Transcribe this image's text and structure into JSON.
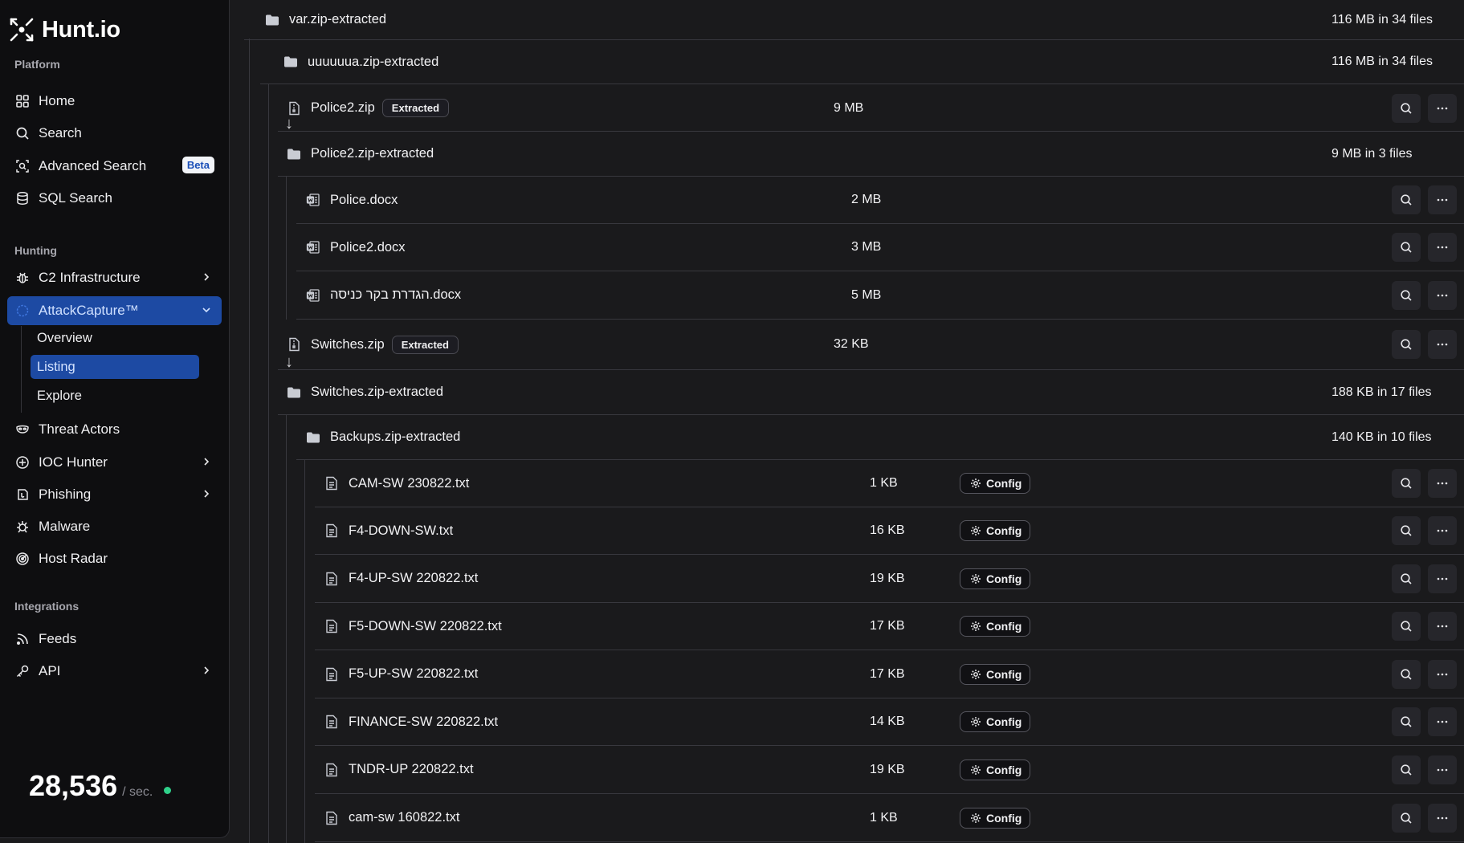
{
  "brand": {
    "name": "Hunt.io"
  },
  "sidebar": {
    "sections": {
      "platform": "Platform",
      "hunting": "Hunting",
      "integrations": "Integrations"
    },
    "items": {
      "home": "Home",
      "search": "Search",
      "advanced_search": "Advanced Search",
      "advanced_search_badge": "Beta",
      "sql_search": "SQL Search",
      "c2_infrastructure": "C2 Infrastructure",
      "attackcapture": "AttackCapture™",
      "threat_actors": "Threat Actors",
      "ioc_hunter": "IOC Hunter",
      "phishing": "Phishing",
      "malware": "Malware",
      "host_radar": "Host Radar",
      "feeds": "Feeds",
      "api": "API"
    },
    "attackcapture_sub": {
      "overview": "Overview",
      "listing": "Listing",
      "explore": "Explore"
    },
    "counter": {
      "value": "28,536",
      "unit": "/ sec."
    }
  },
  "tree": {
    "badges": {
      "extracted": "Extracted",
      "config": "Config"
    },
    "rows": [
      {
        "name": "var.zip-extracted",
        "summary": "116 MB in 34 files"
      },
      {
        "name": "uuuuuua.zip-extracted",
        "summary": "116 MB in 34 files"
      },
      {
        "name": "Police2.zip",
        "size": "9 MB"
      },
      {
        "name": "Police2.zip-extracted",
        "summary": "9 MB in 3 files"
      },
      {
        "name": "Police.docx",
        "size": "2 MB"
      },
      {
        "name": "Police2.docx",
        "size": "3 MB"
      },
      {
        "name": "הגדרת בקר כניסה.docx",
        "size": "5 MB"
      },
      {
        "name": "Switches.zip",
        "size": "32 KB"
      },
      {
        "name": "Switches.zip-extracted",
        "summary": "188 KB in 17 files"
      },
      {
        "name": "Backups.zip-extracted",
        "summary": "140 KB in 10 files"
      },
      {
        "name": "CAM-SW 230822.txt",
        "size": "1 KB"
      },
      {
        "name": "F4-DOWN-SW.txt",
        "size": "16 KB"
      },
      {
        "name": "F4-UP-SW 220822.txt",
        "size": "19 KB"
      },
      {
        "name": "F5-DOWN-SW 220822.txt",
        "size": "17 KB"
      },
      {
        "name": "F5-UP-SW 220822.txt",
        "size": "17 KB"
      },
      {
        "name": "FINANCE-SW 220822.txt",
        "size": "14 KB"
      },
      {
        "name": "TNDR-UP 220822.txt",
        "size": "19 KB"
      },
      {
        "name": "cam-sw 160822.txt",
        "size": "1 KB"
      }
    ]
  },
  "colors": {
    "accent": "#1d4aa3",
    "live_dot": "#2fd08a"
  }
}
